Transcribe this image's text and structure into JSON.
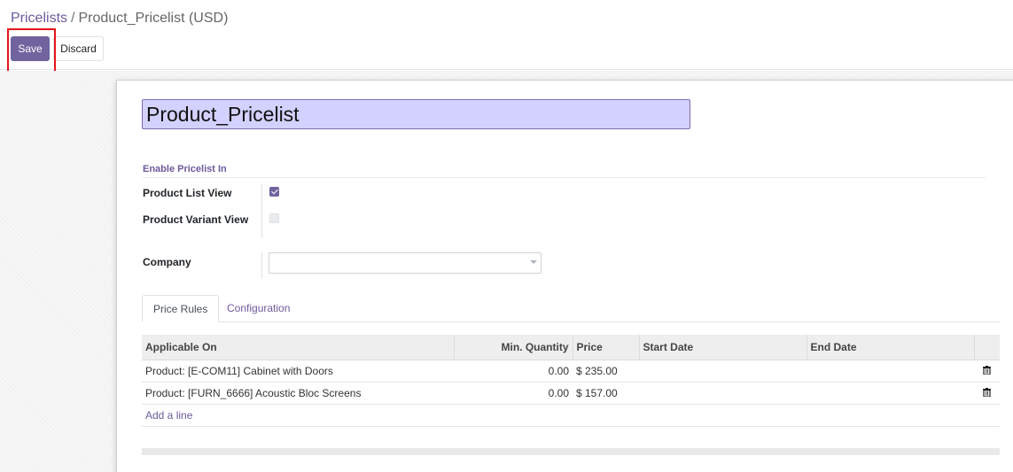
{
  "breadcrumb": {
    "parent": "Pricelists",
    "separator": "/",
    "current": "Product_Pricelist (USD)"
  },
  "toolbar": {
    "save_label": "Save",
    "discard_label": "Discard"
  },
  "form": {
    "name_value": "Product_Pricelist",
    "group_title": "Enable Pricelist In",
    "fields": {
      "product_list_view": {
        "label": "Product List View",
        "checked": true
      },
      "product_variant_view": {
        "label": "Product Variant View",
        "checked": false
      },
      "company": {
        "label": "Company",
        "value": ""
      }
    }
  },
  "tabs": [
    {
      "label": "Price Rules",
      "active": true
    },
    {
      "label": "Configuration",
      "active": false
    }
  ],
  "table": {
    "columns": [
      "Applicable On",
      "Min. Quantity",
      "Price",
      "Start Date",
      "End Date"
    ],
    "rows": [
      {
        "applicable_on": "Product: [E-COM11] Cabinet with Doors",
        "min_quantity": "0.00",
        "price": "$ 235.00",
        "start_date": "",
        "end_date": ""
      },
      {
        "applicable_on": "Product: [FURN_6666] Acoustic Bloc Screens",
        "min_quantity": "0.00",
        "price": "$ 157.00",
        "start_date": "",
        "end_date": ""
      }
    ],
    "add_line_label": "Add a line"
  },
  "colors": {
    "brand": "#71639e",
    "link": "#6d5a9c",
    "name_input_bg": "#d3d1ff",
    "highlight": "#e8141b"
  }
}
